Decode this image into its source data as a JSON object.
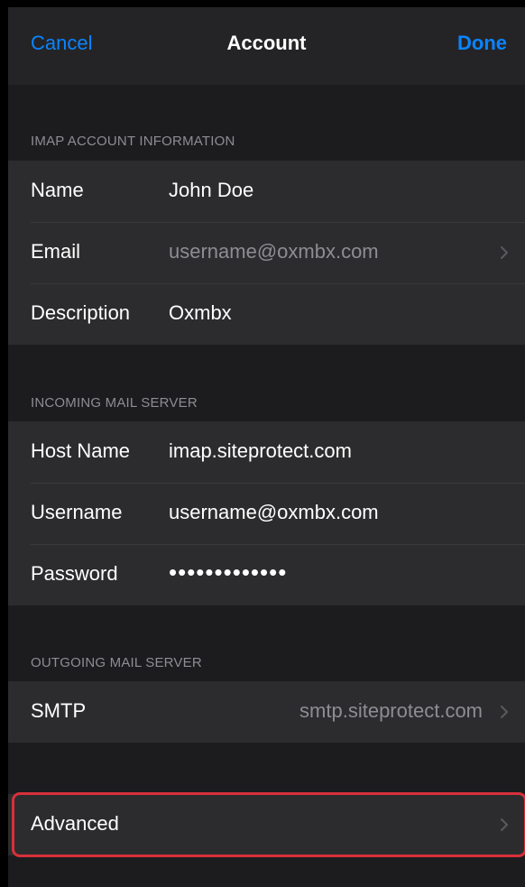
{
  "nav": {
    "cancel_label": "Cancel",
    "title": "Account",
    "done_label": "Done"
  },
  "imap": {
    "header": "IMAP ACCOUNT INFORMATION",
    "rows": [
      {
        "label": "Name",
        "value": "John Doe"
      },
      {
        "label": "Email",
        "value": "username@oxmbx.com"
      },
      {
        "label": "Description",
        "value": "Oxmbx"
      }
    ]
  },
  "incoming": {
    "header": "INCOMING MAIL SERVER",
    "rows": [
      {
        "label": "Host Name",
        "value": "imap.siteprotect.com"
      },
      {
        "label": "Username",
        "value": "username@oxmbx.com"
      },
      {
        "label": "Password",
        "value": "•••••••••••••"
      }
    ]
  },
  "outgoing": {
    "header": "OUTGOING MAIL SERVER",
    "rows": [
      {
        "label": "SMTP",
        "value": "smtp.siteprotect.com"
      }
    ]
  },
  "advanced": {
    "label": "Advanced"
  },
  "colors": {
    "accent": "#0a84ff",
    "background": "#1c1c1e",
    "cell": "#2c2c2e",
    "secondary_text": "#8d8d93",
    "highlight": "#d8303a"
  },
  "icons": {
    "disclosure": "chevron-right-icon"
  }
}
